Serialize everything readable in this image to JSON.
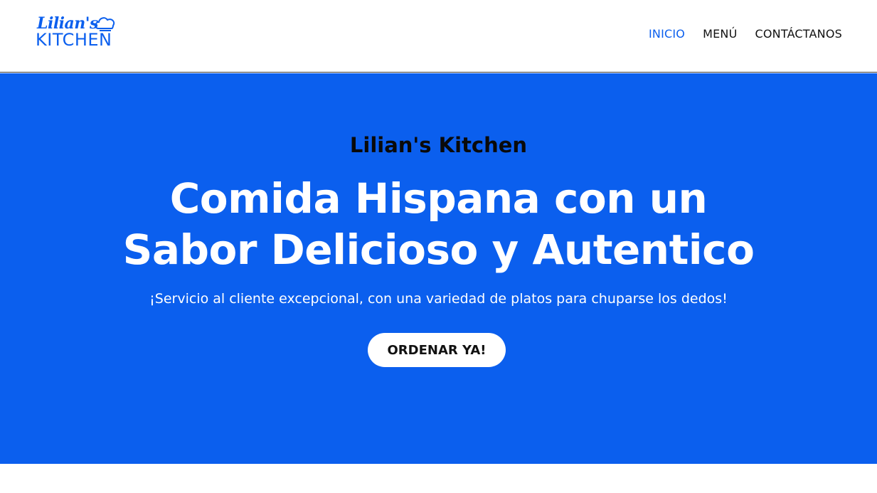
{
  "brand": {
    "logo_top": "Lilian's",
    "logo_bottom": "KITCHEN",
    "accent_color": "#0b5fee"
  },
  "nav": {
    "items": [
      {
        "label": "INICIO",
        "active": true
      },
      {
        "label": "MENÚ",
        "active": false
      },
      {
        "label": "CONTÁCTANOS",
        "active": false
      }
    ]
  },
  "hero": {
    "kicker": "Lilian's Kitchen",
    "title_line1": "Comida Hispana con un",
    "title_line2": "Sabor Delicioso y Autentico",
    "subtitle": "¡Servicio al cliente excepcional, con una variedad de platos para chuparse los dedos!",
    "cta_label": "ORDENAR YA!",
    "background_color": "#0b5fee"
  }
}
